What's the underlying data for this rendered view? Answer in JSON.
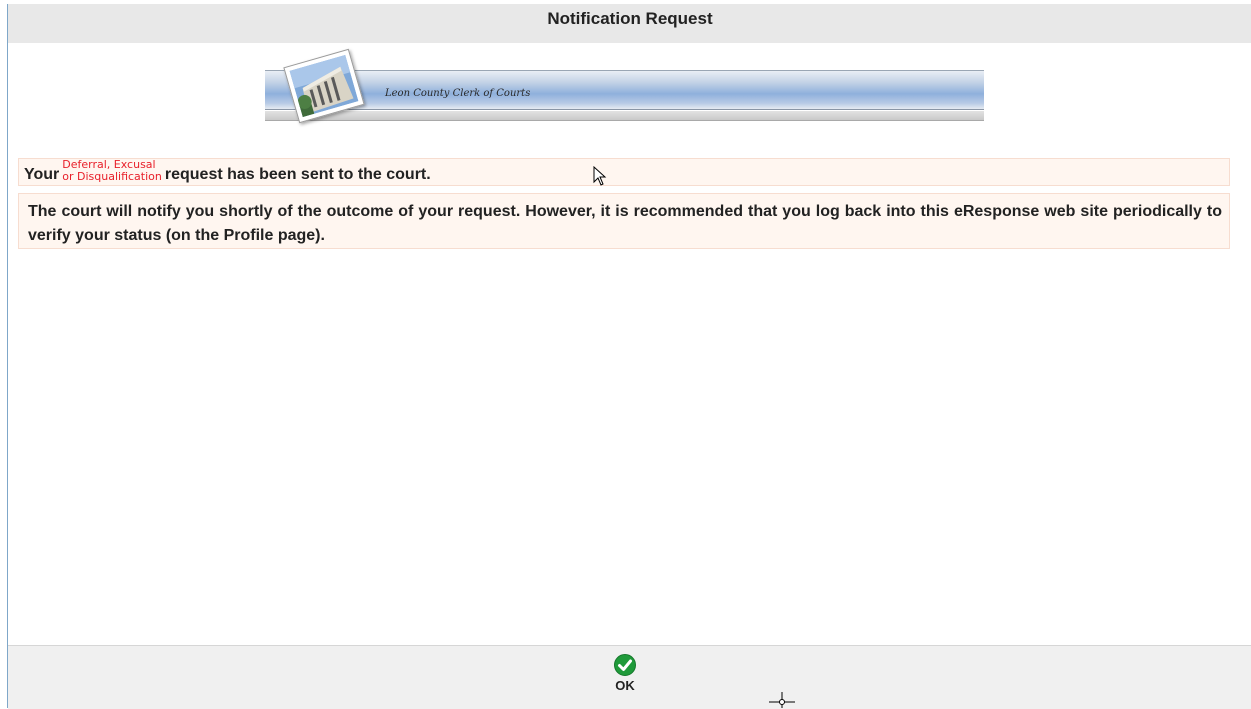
{
  "page": {
    "title": "Notification Request"
  },
  "banner": {
    "text": "Leon County Clerk of Courts"
  },
  "message1": {
    "prefix": "Your",
    "request_type_line1": "Deferral, Excusal",
    "request_type_line2": "or Disqualification",
    "suffix": "request has been sent to the court."
  },
  "message2": {
    "text": "The court will notify you shortly of the outcome of your request. However, it is recommended that you log back into this eResponse web site periodically to verify your status (on the Profile page)."
  },
  "footer": {
    "ok_label": "OK"
  },
  "colors": {
    "title_bar_bg": "#e8e8e8",
    "message_bg": "#fff6f0",
    "request_type_text": "#e8202a",
    "ok_icon": "#1f9a3a"
  },
  "icons": {
    "ok": "check-circle-icon",
    "banner_photo": "courthouse-photo-icon",
    "cursor": "mouse-pointer-icon",
    "crosshair": "crosshair-cursor-icon"
  }
}
